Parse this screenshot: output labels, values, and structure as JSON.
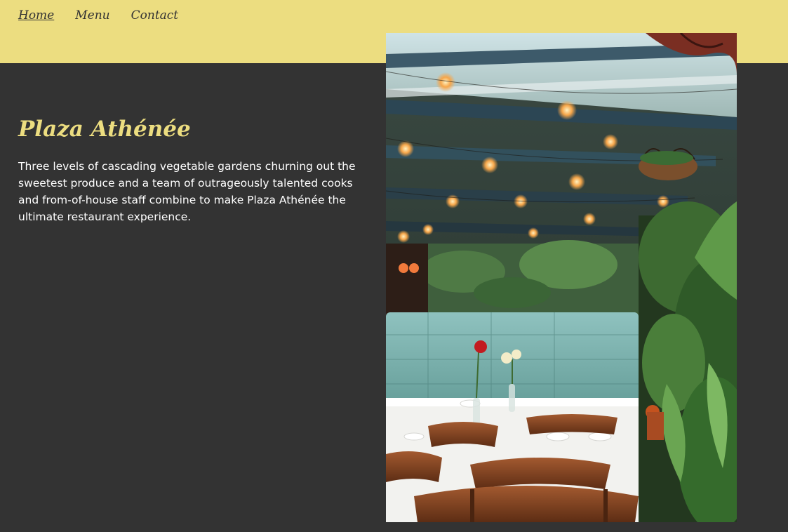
{
  "nav": {
    "items": [
      {
        "label": "Home",
        "active": true
      },
      {
        "label": "Menu",
        "active": false
      },
      {
        "label": "Contact",
        "active": false
      }
    ]
  },
  "hero": {
    "title": "Plaza Athénée",
    "description": "Three levels of cascading vegetable gardens churning out the sweetest produce and a team of outrageously talented cooks and from-of-house staff combine to make Plaza Athénée the ultimate restaurant experience."
  },
  "colors": {
    "accent_yellow": "#ecdd80",
    "background_dark": "#333333",
    "text_light": "#ffffff"
  }
}
